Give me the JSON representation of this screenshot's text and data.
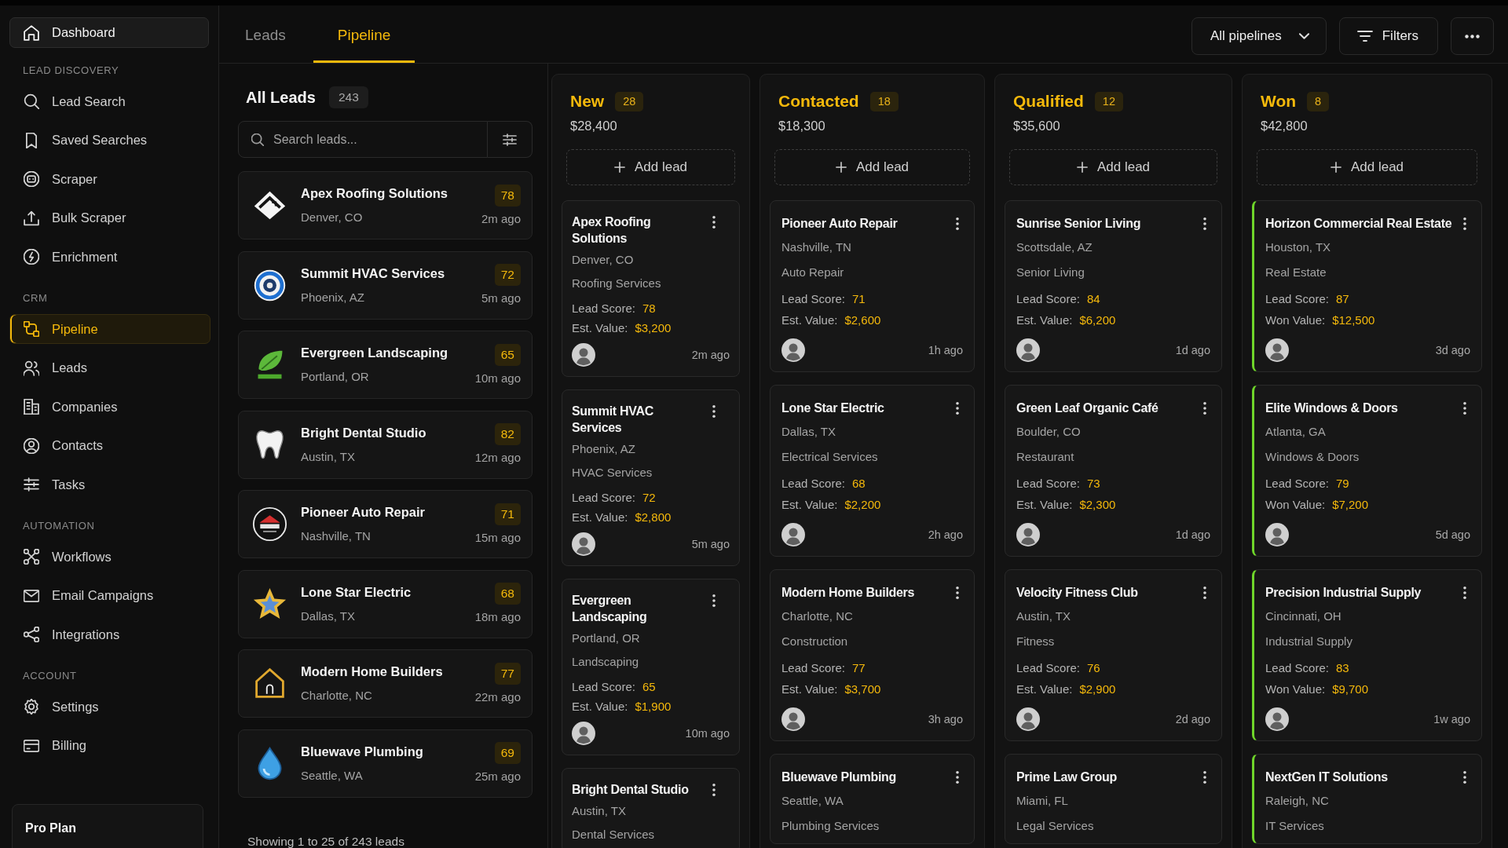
{
  "sidebar": {
    "home": {
      "label": "Dashboard"
    },
    "sections": [
      {
        "title": "LEAD DISCOVERY",
        "items": [
          {
            "label": "Lead Search",
            "selected": false
          },
          {
            "label": "Saved Searches",
            "selected": false
          },
          {
            "label": "Scraper",
            "selected": false
          },
          {
            "label": "Bulk Scraper",
            "selected": false
          },
          {
            "label": "Enrichment",
            "selected": false
          }
        ]
      },
      {
        "title": "CRM",
        "items": [
          {
            "label": "Pipeline",
            "selected": true
          },
          {
            "label": "Leads",
            "selected": false
          },
          {
            "label": "Companies",
            "selected": false
          },
          {
            "label": "Contacts",
            "selected": false
          },
          {
            "label": "Tasks",
            "selected": false
          }
        ]
      },
      {
        "title": "AUTOMATION",
        "items": [
          {
            "label": "Workflows",
            "selected": false
          },
          {
            "label": "Email Campaigns",
            "selected": false
          },
          {
            "label": "Integrations",
            "selected": false
          }
        ]
      },
      {
        "title": "ACCOUNT",
        "items": [
          {
            "label": "Settings",
            "selected": false
          },
          {
            "label": "Billing",
            "selected": false
          }
        ]
      }
    ],
    "plan": {
      "name": "Pro Plan"
    }
  },
  "tabs": [
    {
      "label": "Leads",
      "selected": false
    },
    {
      "label": "Pipeline",
      "selected": true
    }
  ],
  "toolbar": {
    "pipeline_select": {
      "value": "All pipelines"
    },
    "filters_button": {
      "label": "Filters"
    }
  },
  "leads_panel": {
    "title": "All Leads",
    "count": "243",
    "search": {
      "placeholder": "Search leads..."
    },
    "leads": [
      {
        "name": "Apex Roofing Solutions",
        "location": "Denver, CO",
        "score": "78",
        "time": "2m ago"
      },
      {
        "name": "Summit HVAC Services",
        "location": "Phoenix, AZ",
        "score": "72",
        "time": "5m ago"
      },
      {
        "name": "Evergreen Landscaping",
        "location": "Portland, OR",
        "score": "65",
        "time": "10m ago"
      },
      {
        "name": "Bright Dental Studio",
        "location": "Austin, TX",
        "score": "82",
        "time": "12m ago"
      },
      {
        "name": "Pioneer Auto Repair",
        "location": "Nashville, TN",
        "score": "71",
        "time": "15m ago"
      },
      {
        "name": "Lone Star Electric",
        "location": "Dallas, TX",
        "score": "68",
        "time": "18m ago"
      },
      {
        "name": "Modern Home Builders",
        "location": "Charlotte, NC",
        "score": "77",
        "time": "22m ago"
      },
      {
        "name": "Bluewave Plumbing",
        "location": "Seattle, WA",
        "score": "69",
        "time": "25m ago"
      }
    ],
    "footer": "Showing 1 to 25 of 243 leads"
  },
  "pipeline": {
    "columns": [
      {
        "title": "New",
        "count": "28",
        "total": "$28,400",
        "kind": "open",
        "add_label": "Add lead",
        "cards": [
          {
            "name": "Apex Roofing Solutions",
            "location": "Denver, CO",
            "category": "Roofing Services",
            "score_label": "Lead Score:",
            "score": "78",
            "value_label": "Est. Value:",
            "value": "$3,200",
            "time": "2m ago"
          },
          {
            "name": "Summit HVAC Services",
            "location": "Phoenix, AZ",
            "category": "HVAC Services",
            "score_label": "Lead Score:",
            "score": "72",
            "value_label": "Est. Value:",
            "value": "$2,800",
            "time": "5m ago"
          },
          {
            "name": "Evergreen Landscaping",
            "location": "Portland, OR",
            "category": "Landscaping",
            "score_label": "Lead Score:",
            "score": "65",
            "value_label": "Est. Value:",
            "value": "$1,900",
            "time": "10m ago"
          },
          {
            "name": "Bright Dental Studio",
            "location": "Austin, TX",
            "category": "Dental Services"
          }
        ]
      },
      {
        "title": "Contacted",
        "count": "18",
        "total": "$18,300",
        "kind": "open",
        "add_label": "Add lead",
        "cards": [
          {
            "name": "Pioneer Auto Repair",
            "location": "Nashville, TN",
            "category": "Auto Repair",
            "score_label": "Lead Score:",
            "score": "71",
            "value_label": "Est. Value:",
            "value": "$2,600",
            "time": "1h ago"
          },
          {
            "name": "Lone Star Electric",
            "location": "Dallas, TX",
            "category": "Electrical Services",
            "score_label": "Lead Score:",
            "score": "68",
            "value_label": "Est. Value:",
            "value": "$2,200",
            "time": "2h ago"
          },
          {
            "name": "Modern Home Builders",
            "location": "Charlotte, NC",
            "category": "Construction",
            "score_label": "Lead Score:",
            "score": "77",
            "value_label": "Est. Value:",
            "value": "$3,700",
            "time": "3h ago"
          },
          {
            "name": "Bluewave Plumbing",
            "location": "Seattle, WA",
            "category": "Plumbing Services"
          }
        ]
      },
      {
        "title": "Qualified",
        "count": "12",
        "total": "$35,600",
        "kind": "open",
        "add_label": "Add lead",
        "cards": [
          {
            "name": "Sunrise Senior Living",
            "location": "Scottsdale, AZ",
            "category": "Senior Living",
            "score_label": "Lead Score:",
            "score": "84",
            "value_label": "Est. Value:",
            "value": "$6,200",
            "time": "1d ago"
          },
          {
            "name": "Green Leaf Organic Café",
            "location": "Boulder, CO",
            "category": "Restaurant",
            "score_label": "Lead Score:",
            "score": "73",
            "value_label": "Est. Value:",
            "value": "$2,300",
            "time": "1d ago"
          },
          {
            "name": "Velocity Fitness Club",
            "location": "Austin, TX",
            "category": "Fitness",
            "score_label": "Lead Score:",
            "score": "76",
            "value_label": "Est. Value:",
            "value": "$2,900",
            "time": "2d ago"
          },
          {
            "name": "Prime Law Group",
            "location": "Miami, FL",
            "category": "Legal Services"
          }
        ]
      },
      {
        "title": "Won",
        "count": "8",
        "total": "$42,800",
        "kind": "won",
        "add_label": "Add lead",
        "cards": [
          {
            "name": "Horizon Commercial Real Estate",
            "location": "Houston, TX",
            "category": "Real Estate",
            "score_label": "Lead Score:",
            "score": "87",
            "value_label": "Won Value:",
            "value": "$12,500",
            "time": "3d ago"
          },
          {
            "name": "Elite Windows & Doors",
            "location": "Atlanta, GA",
            "category": "Windows & Doors",
            "score_label": "Lead Score:",
            "score": "79",
            "value_label": "Won Value:",
            "value": "$7,200",
            "time": "5d ago"
          },
          {
            "name": "Precision Industrial Supply",
            "location": "Cincinnati, OH",
            "category": "Industrial Supply",
            "score_label": "Lead Score:",
            "score": "83",
            "value_label": "Won Value:",
            "value": "$9,700",
            "time": "1w ago"
          },
          {
            "name": "NextGen IT Solutions",
            "location": "Raleigh, NC",
            "category": "IT Services"
          }
        ]
      }
    ]
  }
}
